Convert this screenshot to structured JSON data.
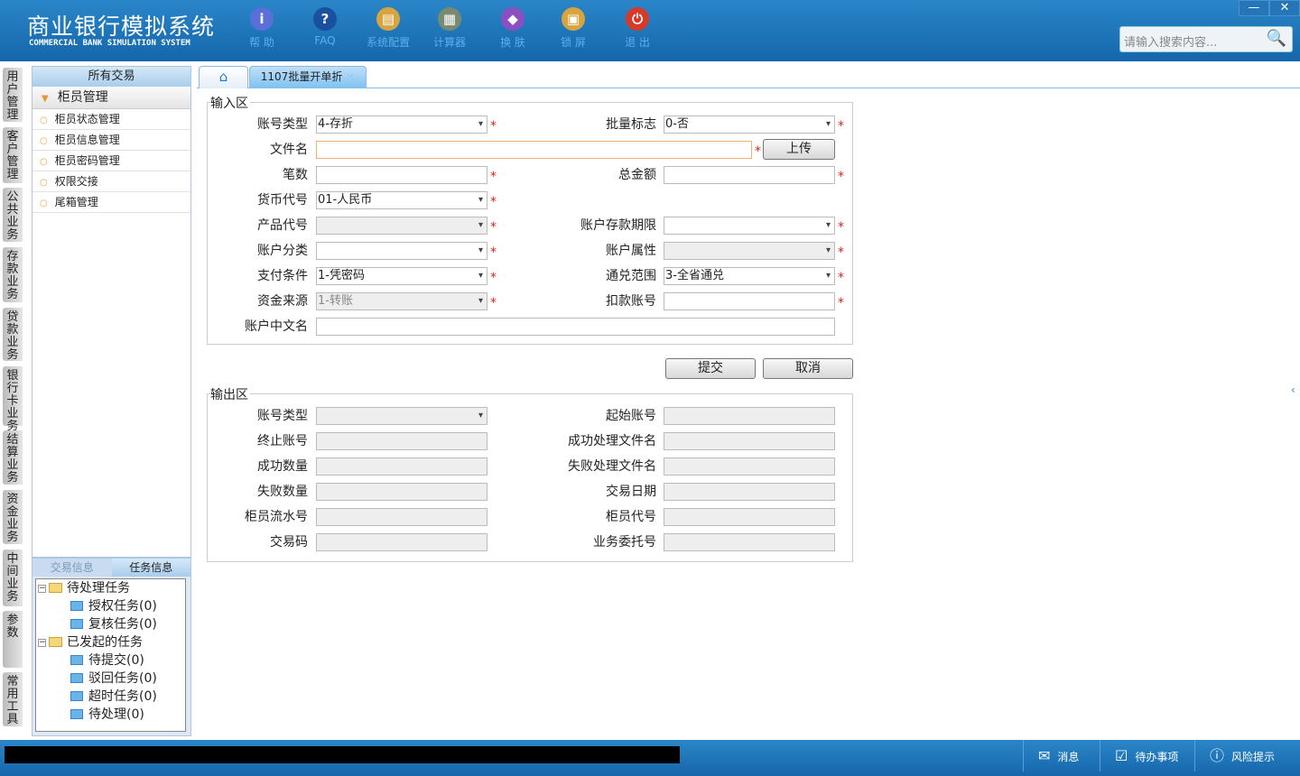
{
  "app": {
    "title": "商业银行模拟系统",
    "subtitle": "COMMERCIAL BANK SIMULATION SYSTEM"
  },
  "toolbar": [
    {
      "label": "帮 助",
      "icon": "info-icon",
      "color": "#5a6fd8",
      "glyph": "i"
    },
    {
      "label": "FAQ",
      "icon": "help-icon",
      "color": "#1b4fa0",
      "glyph": "?"
    },
    {
      "label": "系统配置",
      "icon": "toolbox-icon",
      "color": "#d8a440",
      "glyph": "▤"
    },
    {
      "label": "计算器",
      "icon": "calculator-icon",
      "color": "#7a8a70",
      "glyph": "▦"
    },
    {
      "label": "换 肤",
      "icon": "shirt-icon",
      "color": "#8b4fc0",
      "glyph": "◆"
    },
    {
      "label": "锁 屏",
      "icon": "lock-icon",
      "color": "#d8a440",
      "glyph": "▣"
    },
    {
      "label": "退 出",
      "icon": "power-icon",
      "color": "#d83a2a",
      "glyph": "⏻"
    }
  ],
  "search": {
    "placeholder": "请输入搜索内容..."
  },
  "window": {
    "minimize": "—",
    "close": "✕"
  },
  "vertical_tabs": [
    "用户管理",
    "客户管理",
    "公共业务",
    "存款业务",
    "贷款业务",
    "银行卡业务",
    "结算业务",
    "资金业务",
    "中间业务",
    "参数",
    "常用工具"
  ],
  "sidebar": {
    "header": "所有交易",
    "group": "柜员管理",
    "items": [
      "柜员状态管理",
      "柜员信息管理",
      "柜员密码管理",
      "权限交接",
      "尾箱管理"
    ]
  },
  "task_panel": {
    "tabs": [
      "交易信息",
      "任务信息"
    ],
    "tree": [
      {
        "label": "待处理任务",
        "level": 0
      },
      {
        "label": "授权任务(0)",
        "level": 1
      },
      {
        "label": "复核任务(0)",
        "level": 1
      },
      {
        "label": "已发起的任务",
        "level": 0
      },
      {
        "label": "待提交(0)",
        "level": 1
      },
      {
        "label": "驳回任务(0)",
        "level": 1
      },
      {
        "label": "超时任务(0)",
        "level": 1
      },
      {
        "label": "待处理(0)",
        "level": 1
      }
    ]
  },
  "tabs": {
    "active": "1107批量开单折",
    "close": "×"
  },
  "input_section": {
    "legend": "输入区",
    "rows": [
      [
        {
          "label": "账号类型",
          "value": "4-存折",
          "type": "select",
          "req": true
        },
        {
          "label": "批量标志",
          "value": "0-否",
          "type": "select",
          "req": true
        }
      ],
      [
        {
          "label": "文件名",
          "value": "",
          "type": "file",
          "req": true
        }
      ],
      [
        {
          "label": "笔数",
          "value": "",
          "type": "text",
          "req": true
        },
        {
          "label": "总金额",
          "value": "",
          "type": "text",
          "req": true
        }
      ],
      [
        {
          "label": "货币代号",
          "value": "01-人民币",
          "type": "select",
          "req": true
        }
      ],
      [
        {
          "label": "产品代号",
          "value": "",
          "type": "select-dis",
          "req": true
        },
        {
          "label": "账户存款期限",
          "value": "",
          "type": "select",
          "req": true
        }
      ],
      [
        {
          "label": "账户分类",
          "value": "",
          "type": "select",
          "req": true
        },
        {
          "label": "账户属性",
          "value": "",
          "type": "select-dis",
          "req": true
        }
      ],
      [
        {
          "label": "支付条件",
          "value": "1-凭密码",
          "type": "select",
          "req": true
        },
        {
          "label": "通兑范围",
          "value": "3-全省通兑",
          "type": "select",
          "req": true
        }
      ],
      [
        {
          "label": "资金来源",
          "value": "1-转账",
          "type": "select-dis",
          "req": true
        },
        {
          "label": "扣款账号",
          "value": "",
          "type": "text",
          "req": true
        }
      ],
      [
        {
          "label": "账户中文名",
          "value": "",
          "type": "wide",
          "req": false
        }
      ]
    ],
    "upload": "上传",
    "star": "*"
  },
  "actions": {
    "submit": "提交",
    "cancel": "取消"
  },
  "output_section": {
    "legend": "输出区",
    "rows": [
      [
        {
          "label": "账号类型",
          "value": "",
          "type": "select-dis"
        },
        {
          "label": "起始账号",
          "value": "",
          "type": "dis"
        }
      ],
      [
        {
          "label": "终止账号",
          "value": "",
          "type": "dis"
        },
        {
          "label": "成功处理文件名",
          "value": "",
          "type": "dis"
        }
      ],
      [
        {
          "label": "成功数量",
          "value": "",
          "type": "dis"
        },
        {
          "label": "失败处理文件名",
          "value": "",
          "type": "dis"
        }
      ],
      [
        {
          "label": "失败数量",
          "value": "",
          "type": "dis"
        },
        {
          "label": "交易日期",
          "value": "",
          "type": "dis"
        }
      ],
      [
        {
          "label": "柜员流水号",
          "value": "",
          "type": "dis"
        },
        {
          "label": "柜员代号",
          "value": "",
          "type": "dis"
        }
      ],
      [
        {
          "label": "交易码",
          "value": "",
          "type": "dis"
        },
        {
          "label": "业务委托号",
          "value": "",
          "type": "dis"
        }
      ]
    ]
  },
  "footer": {
    "items": [
      {
        "label": "消息",
        "icon": "mail-icon",
        "glyph": "✉"
      },
      {
        "label": "待办事项",
        "icon": "checkbox-icon",
        "glyph": "☑"
      },
      {
        "label": "风险提示",
        "icon": "alert-bubble-icon",
        "glyph": "ⓘ"
      }
    ]
  }
}
